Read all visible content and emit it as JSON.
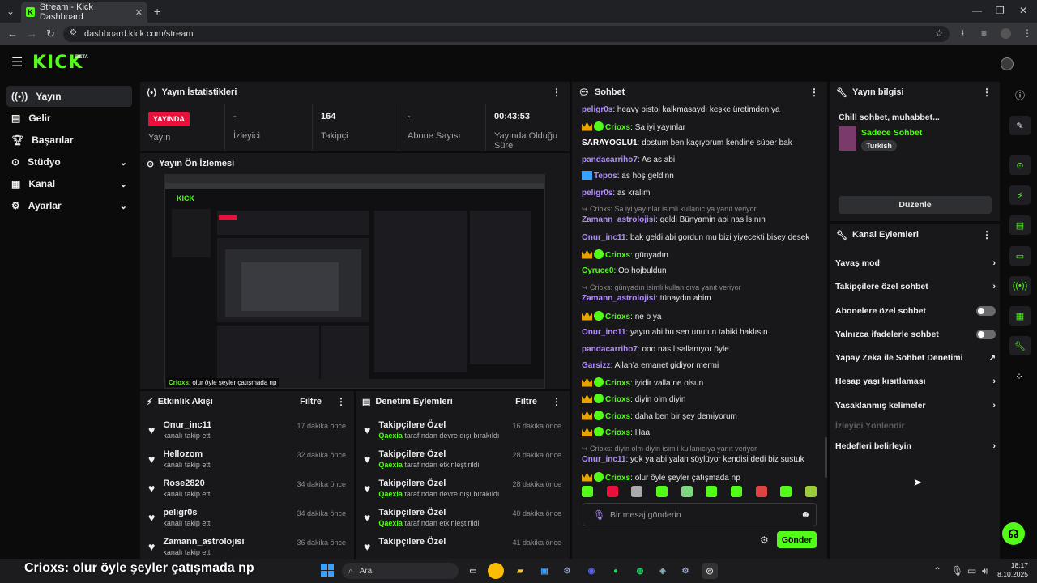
{
  "browser": {
    "tab_title": "Stream - Kick Dashboard",
    "url": "dashboard.kick.com/stream"
  },
  "header": {
    "logo": "KICK",
    "beta": "BETA"
  },
  "sidebar": {
    "items": [
      {
        "label": "Yayın",
        "icon": "broadcast-icon",
        "active": true
      },
      {
        "label": "Gelir",
        "icon": "revenue-icon"
      },
      {
        "label": "Başarılar",
        "icon": "trophy-icon"
      },
      {
        "label": "Stüdyo",
        "icon": "studio-icon",
        "expandable": true
      },
      {
        "label": "Kanal",
        "icon": "channel-icon",
        "expandable": true
      },
      {
        "label": "Ayarlar",
        "icon": "gear-icon",
        "expandable": true
      }
    ]
  },
  "stats": {
    "title": "Yayın İstatistikleri",
    "live_badge": "YAYINDA",
    "live_label": "Yayın",
    "viewers_value": "-",
    "viewers_label": "İzleyici",
    "followers_value": "164",
    "followers_label": "Takipçi",
    "subs_value": "-",
    "subs_label": "Abone Sayısı",
    "duration_value": "00:43:53",
    "duration_label": "Yayında Olduğu Süre"
  },
  "preview": {
    "title": "Yayın Ön İzlemesi",
    "caption_user": "Crioxs",
    "caption_text": ": olur öyle şeyler çatışmada np"
  },
  "activity": {
    "title": "Etkinlik Akışı",
    "filter": "Filtre",
    "rows": [
      {
        "name": "Onur_inc11",
        "sub": "kanalı takip etti",
        "time": "17 dakika önce"
      },
      {
        "name": "Hellozom",
        "sub": "kanalı takip etti",
        "time": "32 dakika önce"
      },
      {
        "name": "Rose2820",
        "sub": "kanalı takip etti",
        "time": "34 dakika önce"
      },
      {
        "name": "peligr0s",
        "sub": "kanalı takip etti",
        "time": "34 dakika önce"
      },
      {
        "name": "Zamann_astrolojisi",
        "sub": "kanalı takip etti",
        "time": "36 dakika önce"
      }
    ]
  },
  "moderation": {
    "title": "Denetim Eylemleri",
    "filter": "Filtre",
    "rows": [
      {
        "name": "Takipçilere Özel",
        "actor": "Qaexia",
        "sub": "tarafından devre dışı bırakıldı",
        "time": "16 dakika önce"
      },
      {
        "name": "Takipçilere Özel",
        "actor": "Qaexia",
        "sub": "tarafından etkinleştirildi",
        "time": "28 dakika önce"
      },
      {
        "name": "Takipçilere Özel",
        "actor": "Qaexia",
        "sub": "tarafından devre dışı bırakıldı",
        "time": "28 dakika önce"
      },
      {
        "name": "Takipçilere Özel",
        "actor": "Qaexia",
        "sub": "tarafından etkinleştirildi",
        "time": "40 dakika önce"
      },
      {
        "name": "Takipçilere Özel",
        "actor": "",
        "sub": "",
        "time": "41 dakika önce"
      }
    ]
  },
  "chat": {
    "title": "Sohbet",
    "input_placeholder": "Bir mesaj gönderin",
    "send": "Gönder",
    "messages": [
      {
        "user": "peligr0s",
        "color": "#b18cff",
        "badges": [],
        "text": "heavy pistol kalkmasaydı keşke üretimden ya"
      },
      {
        "user": "Crioxs",
        "color": "#53fc18",
        "badges": [
          "crown",
          "ver"
        ],
        "text": "Sa iyi yayınlar"
      },
      {
        "user": "SARAYOGLU1",
        "color": "#ffffff",
        "badges": [],
        "text": "dostum ben kaçıyorum kendine süper bak"
      },
      {
        "user": "pandacarriho7",
        "color": "#b18cff",
        "badges": [],
        "text": "As as abi"
      },
      {
        "user": "Tepos",
        "color": "#b18cff",
        "badges": [
          "blue"
        ],
        "text": "as hoş geldinn"
      },
      {
        "user": "peligr0s",
        "color": "#b18cff",
        "badges": [],
        "text": "as kralım"
      },
      {
        "reply": "↪ Crioxs: Sa iyi yayınlar isimli kullanıcıya yanıt veriyor",
        "user": "Zamann_astrolojisi",
        "color": "#b18cff",
        "badges": [],
        "text": "geldi Bünyamin abi nasılsının"
      },
      {
        "user": "Onur_inc11",
        "color": "#b18cff",
        "badges": [],
        "text": "bak geldi abi gordun mu bizi yiyecekti bisey desek"
      },
      {
        "user": "Crioxs",
        "color": "#53fc18",
        "badges": [
          "crown",
          "ver"
        ],
        "text": "günyadın"
      },
      {
        "user": "Cyruce0",
        "color": "#53fc18",
        "badges": [],
        "text": "Oo hojbuldun"
      },
      {
        "reply": "↪ Crioxs: günyadın isimli kullanıcıya yanıt veriyor",
        "user": "Zamann_astrolojisi",
        "color": "#b18cff",
        "badges": [],
        "text": "tünaydın abim"
      },
      {
        "user": "Crioxs",
        "color": "#53fc18",
        "badges": [
          "crown",
          "ver"
        ],
        "text": "ne o ya"
      },
      {
        "user": "Onur_inc11",
        "color": "#b18cff",
        "badges": [],
        "text": "yayın abi bu sen unutun tabiki haklısın"
      },
      {
        "user": "pandacarriho7",
        "color": "#b18cff",
        "badges": [],
        "text": "ooo nasıl sallanıyor öyle"
      },
      {
        "user": "Garsizz",
        "color": "#b18cff",
        "badges": [],
        "text": "Allah'a emanet gidiyor mermi"
      },
      {
        "user": "Crioxs",
        "color": "#53fc18",
        "badges": [
          "crown",
          "ver"
        ],
        "text": "iyidir valla ne olsun"
      },
      {
        "user": "Crioxs",
        "color": "#53fc18",
        "badges": [
          "crown",
          "ver"
        ],
        "text": "diyin olm diyin"
      },
      {
        "user": "Crioxs",
        "color": "#53fc18",
        "badges": [
          "crown",
          "ver"
        ],
        "text": "daha ben bir şey demiyorum"
      },
      {
        "user": "Crioxs",
        "color": "#53fc18",
        "badges": [
          "crown",
          "ver"
        ],
        "text": "Haa"
      },
      {
        "reply": "↪ Crioxs: diyin olm diyin isimli kullanıcıya yanıt veriyor",
        "user": "Onur_inc11",
        "color": "#b18cff",
        "badges": [],
        "text": "yok ya abi yalan söylüyor kendisi dedi biz sustuk"
      },
      {
        "user": "Crioxs",
        "color": "#53fc18",
        "badges": [
          "crown",
          "ver"
        ],
        "text": "olur öyle şeyler çatışmada np"
      }
    ]
  },
  "info": {
    "title": "Yayın bilgisi",
    "stream_title": "Chill sohbet, muhabbet...",
    "category": "Sadece Sohbet",
    "tag": "Turkish",
    "edit": "Düzenle"
  },
  "channel_actions": {
    "title": "Kanal Eylemleri",
    "items": [
      {
        "label": "Yavaş mod",
        "kind": "arrow"
      },
      {
        "label": "Takipçilere özel sohbet",
        "kind": "arrow"
      },
      {
        "label": "Abonelere özel sohbet",
        "kind": "toggle"
      },
      {
        "label": "Yalnızca ifadelerle sohbet",
        "kind": "toggle"
      },
      {
        "label": "Yapay Zeka ile Sohbet Denetimi",
        "kind": "external"
      },
      {
        "label": "Hesap yaşı kısıtlaması",
        "kind": "arrow"
      },
      {
        "label": "Yasaklanmış kelimeler",
        "kind": "arrow"
      },
      {
        "label": "İzleyici Yönlendir",
        "kind": "disabled"
      },
      {
        "label": "Hedefleri belirleyin",
        "kind": "arrow"
      }
    ]
  },
  "overlay": {
    "user": "Crioxs",
    "text": ": olur öyle şeyler çatışmada np"
  },
  "taskbar": {
    "search": "Ara",
    "time": "18:17",
    "date": "8.10.2025"
  }
}
